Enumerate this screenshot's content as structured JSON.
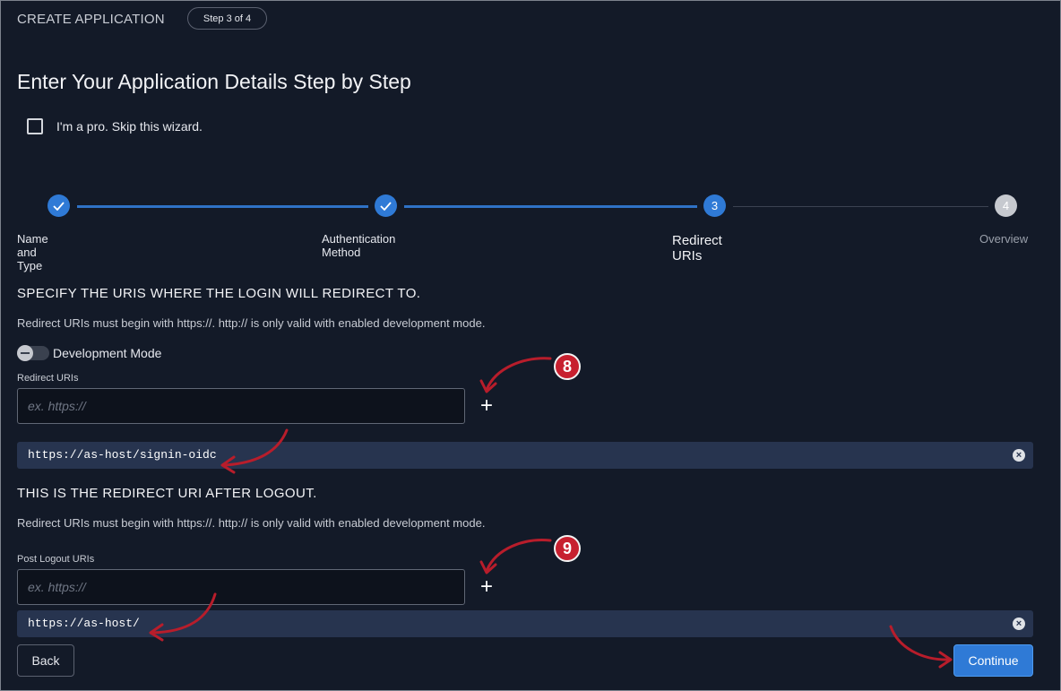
{
  "header": {
    "title": "CREATE APPLICATION",
    "step_indicator": "Step 3 of 4"
  },
  "page": {
    "title": "Enter Your Application Details Step by Step",
    "skip_wizard_label": "I'm a pro. Skip this wizard.",
    "skip_wizard_checked": false
  },
  "stepper": {
    "steps": [
      {
        "number": "1",
        "label": "Name and Type",
        "state": "done"
      },
      {
        "number": "2",
        "label": "Authentication Method",
        "state": "done"
      },
      {
        "number": "3",
        "label": "Redirect URIs",
        "state": "active"
      },
      {
        "number": "4",
        "label": "Overview",
        "state": "pending"
      }
    ]
  },
  "redirect_section": {
    "heading": "SPECIFY THE URIS WHERE THE LOGIN WILL REDIRECT TO.",
    "description": "Redirect URIs must begin with https://. http:// is only valid with enabled development mode.",
    "dev_mode_label": "Development Mode",
    "dev_mode_enabled": false,
    "field_label": "Redirect URIs",
    "placeholder": "ex. https://",
    "value": "",
    "add_symbol": "+",
    "uris": [
      "https://as-host/signin-oidc"
    ],
    "annotation_number": "8"
  },
  "logout_section": {
    "heading": "THIS IS THE REDIRECT URI AFTER LOGOUT.",
    "description": "Redirect URIs must begin with https://. http:// is only valid with enabled development mode.",
    "field_label": "Post Logout URIs",
    "placeholder": "ex. https://",
    "value": "",
    "add_symbol": "+",
    "uris": [
      "https://as-host/"
    ],
    "annotation_number": "9"
  },
  "footer": {
    "back_label": "Back",
    "continue_label": "Continue"
  },
  "colors": {
    "background": "#131a28",
    "accent": "#2f7ad6",
    "chip": "#27344f",
    "annotation": "#c7202f"
  },
  "icons": {
    "check": "check-icon",
    "close": "close-circle-icon",
    "plus": "plus-icon",
    "toggle": "toggle-switch"
  }
}
